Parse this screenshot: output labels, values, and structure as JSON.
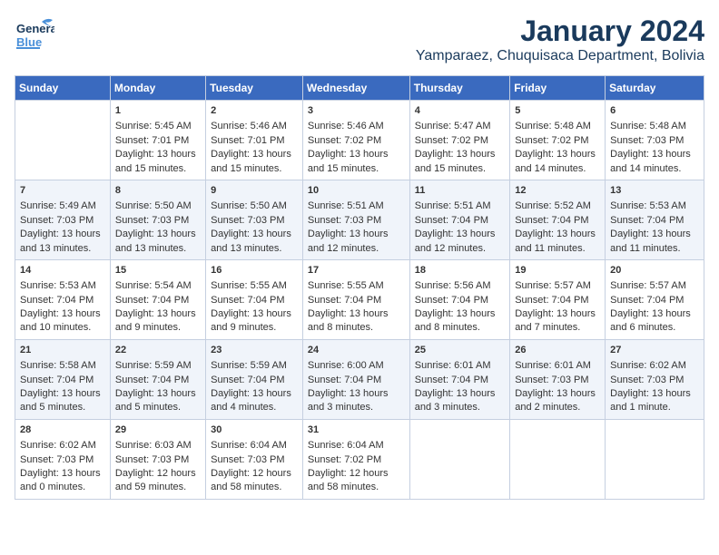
{
  "header": {
    "logo_general": "General",
    "logo_blue": "Blue",
    "title": "January 2024",
    "subtitle": "Yamparaez, Chuquisaca Department, Bolivia"
  },
  "days_of_week": [
    "Sunday",
    "Monday",
    "Tuesday",
    "Wednesday",
    "Thursday",
    "Friday",
    "Saturday"
  ],
  "weeks": [
    [
      {
        "day": "",
        "sunrise": "",
        "sunset": "",
        "daylight": ""
      },
      {
        "day": "1",
        "sunrise": "5:45 AM",
        "sunset": "7:01 PM",
        "daylight": "13 hours and 15 minutes."
      },
      {
        "day": "2",
        "sunrise": "5:46 AM",
        "sunset": "7:01 PM",
        "daylight": "13 hours and 15 minutes."
      },
      {
        "day": "3",
        "sunrise": "5:46 AM",
        "sunset": "7:02 PM",
        "daylight": "13 hours and 15 minutes."
      },
      {
        "day": "4",
        "sunrise": "5:47 AM",
        "sunset": "7:02 PM",
        "daylight": "13 hours and 15 minutes."
      },
      {
        "day": "5",
        "sunrise": "5:48 AM",
        "sunset": "7:02 PM",
        "daylight": "13 hours and 14 minutes."
      },
      {
        "day": "6",
        "sunrise": "5:48 AM",
        "sunset": "7:03 PM",
        "daylight": "13 hours and 14 minutes."
      }
    ],
    [
      {
        "day": "7",
        "sunrise": "5:49 AM",
        "sunset": "7:03 PM",
        "daylight": "13 hours and 13 minutes."
      },
      {
        "day": "8",
        "sunrise": "5:50 AM",
        "sunset": "7:03 PM",
        "daylight": "13 hours and 13 minutes."
      },
      {
        "day": "9",
        "sunrise": "5:50 AM",
        "sunset": "7:03 PM",
        "daylight": "13 hours and 13 minutes."
      },
      {
        "day": "10",
        "sunrise": "5:51 AM",
        "sunset": "7:03 PM",
        "daylight": "13 hours and 12 minutes."
      },
      {
        "day": "11",
        "sunrise": "5:51 AM",
        "sunset": "7:04 PM",
        "daylight": "13 hours and 12 minutes."
      },
      {
        "day": "12",
        "sunrise": "5:52 AM",
        "sunset": "7:04 PM",
        "daylight": "13 hours and 11 minutes."
      },
      {
        "day": "13",
        "sunrise": "5:53 AM",
        "sunset": "7:04 PM",
        "daylight": "13 hours and 11 minutes."
      }
    ],
    [
      {
        "day": "14",
        "sunrise": "5:53 AM",
        "sunset": "7:04 PM",
        "daylight": "13 hours and 10 minutes."
      },
      {
        "day": "15",
        "sunrise": "5:54 AM",
        "sunset": "7:04 PM",
        "daylight": "13 hours and 9 minutes."
      },
      {
        "day": "16",
        "sunrise": "5:55 AM",
        "sunset": "7:04 PM",
        "daylight": "13 hours and 9 minutes."
      },
      {
        "day": "17",
        "sunrise": "5:55 AM",
        "sunset": "7:04 PM",
        "daylight": "13 hours and 8 minutes."
      },
      {
        "day": "18",
        "sunrise": "5:56 AM",
        "sunset": "7:04 PM",
        "daylight": "13 hours and 8 minutes."
      },
      {
        "day": "19",
        "sunrise": "5:57 AM",
        "sunset": "7:04 PM",
        "daylight": "13 hours and 7 minutes."
      },
      {
        "day": "20",
        "sunrise": "5:57 AM",
        "sunset": "7:04 PM",
        "daylight": "13 hours and 6 minutes."
      }
    ],
    [
      {
        "day": "21",
        "sunrise": "5:58 AM",
        "sunset": "7:04 PM",
        "daylight": "13 hours and 5 minutes."
      },
      {
        "day": "22",
        "sunrise": "5:59 AM",
        "sunset": "7:04 PM",
        "daylight": "13 hours and 5 minutes."
      },
      {
        "day": "23",
        "sunrise": "5:59 AM",
        "sunset": "7:04 PM",
        "daylight": "13 hours and 4 minutes."
      },
      {
        "day": "24",
        "sunrise": "6:00 AM",
        "sunset": "7:04 PM",
        "daylight": "13 hours and 3 minutes."
      },
      {
        "day": "25",
        "sunrise": "6:01 AM",
        "sunset": "7:04 PM",
        "daylight": "13 hours and 3 minutes."
      },
      {
        "day": "26",
        "sunrise": "6:01 AM",
        "sunset": "7:03 PM",
        "daylight": "13 hours and 2 minutes."
      },
      {
        "day": "27",
        "sunrise": "6:02 AM",
        "sunset": "7:03 PM",
        "daylight": "13 hours and 1 minute."
      }
    ],
    [
      {
        "day": "28",
        "sunrise": "6:02 AM",
        "sunset": "7:03 PM",
        "daylight": "13 hours and 0 minutes."
      },
      {
        "day": "29",
        "sunrise": "6:03 AM",
        "sunset": "7:03 PM",
        "daylight": "12 hours and 59 minutes."
      },
      {
        "day": "30",
        "sunrise": "6:04 AM",
        "sunset": "7:03 PM",
        "daylight": "12 hours and 58 minutes."
      },
      {
        "day": "31",
        "sunrise": "6:04 AM",
        "sunset": "7:02 PM",
        "daylight": "12 hours and 58 minutes."
      },
      {
        "day": "",
        "sunrise": "",
        "sunset": "",
        "daylight": ""
      },
      {
        "day": "",
        "sunrise": "",
        "sunset": "",
        "daylight": ""
      },
      {
        "day": "",
        "sunrise": "",
        "sunset": "",
        "daylight": ""
      }
    ]
  ],
  "labels": {
    "sunrise": "Sunrise:",
    "sunset": "Sunset:",
    "daylight": "Daylight:"
  },
  "colors": {
    "header_bg": "#3a6abf",
    "header_text": "#ffffff",
    "title_color": "#1a3a5c",
    "logo_blue": "#4a90d9"
  }
}
